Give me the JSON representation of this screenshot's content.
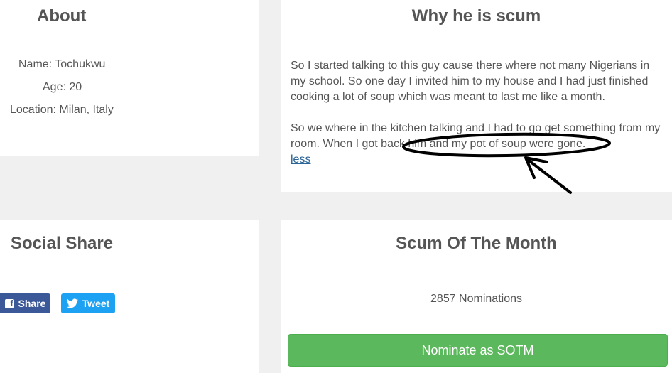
{
  "about": {
    "title": "About",
    "name": "Name: Tochukwu",
    "age": "Age: 20",
    "location": "Location: Milan, Italy"
  },
  "why": {
    "title": "Why he is scum",
    "paragraph1": "So I started talking to this guy cause there where not many Nigerians in my school. So one day I invited him to my house and I had just finished cooking a lot of soup which was meant to last me like a month.",
    "paragraph2": "So we where in the kitchen talking and I had to go get something from my room. When I got back him and my pot of soup were gone.",
    "less_link": "less"
  },
  "social": {
    "title": "Social Share",
    "share_label": "Share",
    "tweet_label": "Tweet",
    "facebook_color": "#3b5998",
    "twitter_color": "#1da1f2"
  },
  "sotm": {
    "title": "Scum Of The Month",
    "nominations": "2857 Nominations",
    "nominate_label": "Nominate as SOTM",
    "button_color": "#5cb85c"
  }
}
